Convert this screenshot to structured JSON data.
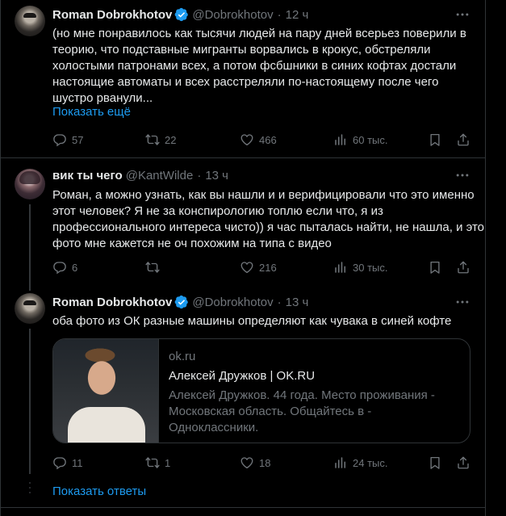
{
  "tweets": [
    {
      "author": "Roman Dobrokhotov",
      "handle": "@Dobrokhotov",
      "time": "12 ч",
      "lines": [
        "(но мне понравилось как тысячи людей на пару дней всерьез поверили в",
        "теорию, что подставные мигранты ворвались в крокус, обстреляли",
        "холостыми патронами всех, а потом фсбшники в синих кофтах достали",
        "настоящие автоматы и всех расстреляли по-настоящему после чего",
        "шустро рванули..."
      ],
      "show_more": "Показать ещё",
      "replies": "57",
      "reposts": "22",
      "likes": "466",
      "views": "60 тыс."
    },
    {
      "author": "вик ты чего",
      "handle": "@KantWilde",
      "time": "13 ч",
      "lines": [
        "Роман, а можно узнать, как вы нашли и и верифицировали что это именно",
        "этот человек? Я не за конспирологию топлю если что, я из",
        "профессионального интереса чисто)) я час пыталась найти, не нашла, и это",
        "фото мне кажется не оч похожим на типа с видео"
      ],
      "replies": "6",
      "reposts": "",
      "likes": "216",
      "views": "30 тыс."
    },
    {
      "author": "Roman Dobrokhotov",
      "handle": "@Dobrokhotov",
      "time": "13 ч",
      "lines": [
        "оба фото из ОК разные машины определяют как чувака в синей кофте"
      ],
      "card": {
        "domain": "ok.ru",
        "title": "Алексей Дружков | OK.RU",
        "desc_lines": [
          "Алексей Дружков. 44 года. Место проживания -",
          "Московская область. Общайтесь в - Одноклассники."
        ]
      },
      "replies": "11",
      "reposts": "1",
      "likes": "18",
      "views": "24 тыс."
    }
  ],
  "show_replies": "Показать ответы",
  "colors": {
    "background": "#000000",
    "text": "#e7e9ea",
    "muted": "#71767b",
    "accent": "#1d9bf0",
    "border": "#2f3336"
  },
  "icons": [
    "verified-badge-icon",
    "more-icon",
    "reply-icon",
    "repost-icon",
    "like-icon",
    "views-icon",
    "bookmark-icon",
    "share-icon"
  ]
}
